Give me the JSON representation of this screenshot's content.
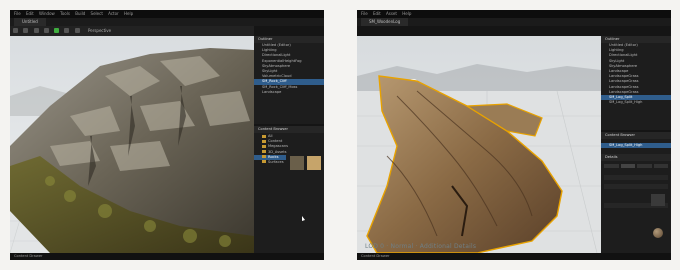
{
  "left": {
    "menu": [
      "File",
      "Edit",
      "Window",
      "Tools",
      "Build",
      "Select",
      "Actor",
      "Help"
    ],
    "project_tab": "Untitled",
    "viewport_label": "Perspective",
    "outliner_title": "Outliner",
    "outliner_rows": [
      "Untitled (Editor)",
      "Lighting",
      "DirectionalLight",
      "ExponentialHeightFog",
      "SkyAtmosphere",
      "SkyLight",
      "VolumetricCloud",
      "SM_Rock_Cliff",
      "SM_Rock_Cliff_Moss",
      "Landscape"
    ],
    "details_title": "Details",
    "content_browser": "Content Browser",
    "cb_tree": [
      "All",
      "Content",
      "Megascans",
      "3D_Assets",
      "Rocks",
      "Surfaces"
    ],
    "statusbar": "Content Drawer"
  },
  "right": {
    "menu": [
      "File",
      "Edit",
      "Asset",
      "Help"
    ],
    "project_tab": "SM_WoodenLog",
    "outliner_title": "Outliner",
    "details_title": "Details",
    "outliner_rows": [
      "Untitled (Editor)",
      "Lighting",
      "DirectionalLight",
      "SkyLight",
      "SkyAtmosphere",
      "Landscape",
      "LandscapeGrass",
      "LandscapeGrass",
      "LandscapeGrass",
      "LandscapeGrass",
      "SM_Log_Split",
      "SM_Log_Split_High"
    ],
    "content_browser": "Content Browser",
    "selected_asset": "SM_Log_Split_High",
    "viewport_caption": "LOD 0 · Normal · Additional Details",
    "statusbar": "Content Drawer"
  },
  "colors": {
    "editor_bg": "#151515",
    "panel_bg": "#1d1d1d",
    "selection": "#2f5d8c",
    "outline": "#e8a200",
    "page_bg": "#f4f3f1"
  }
}
